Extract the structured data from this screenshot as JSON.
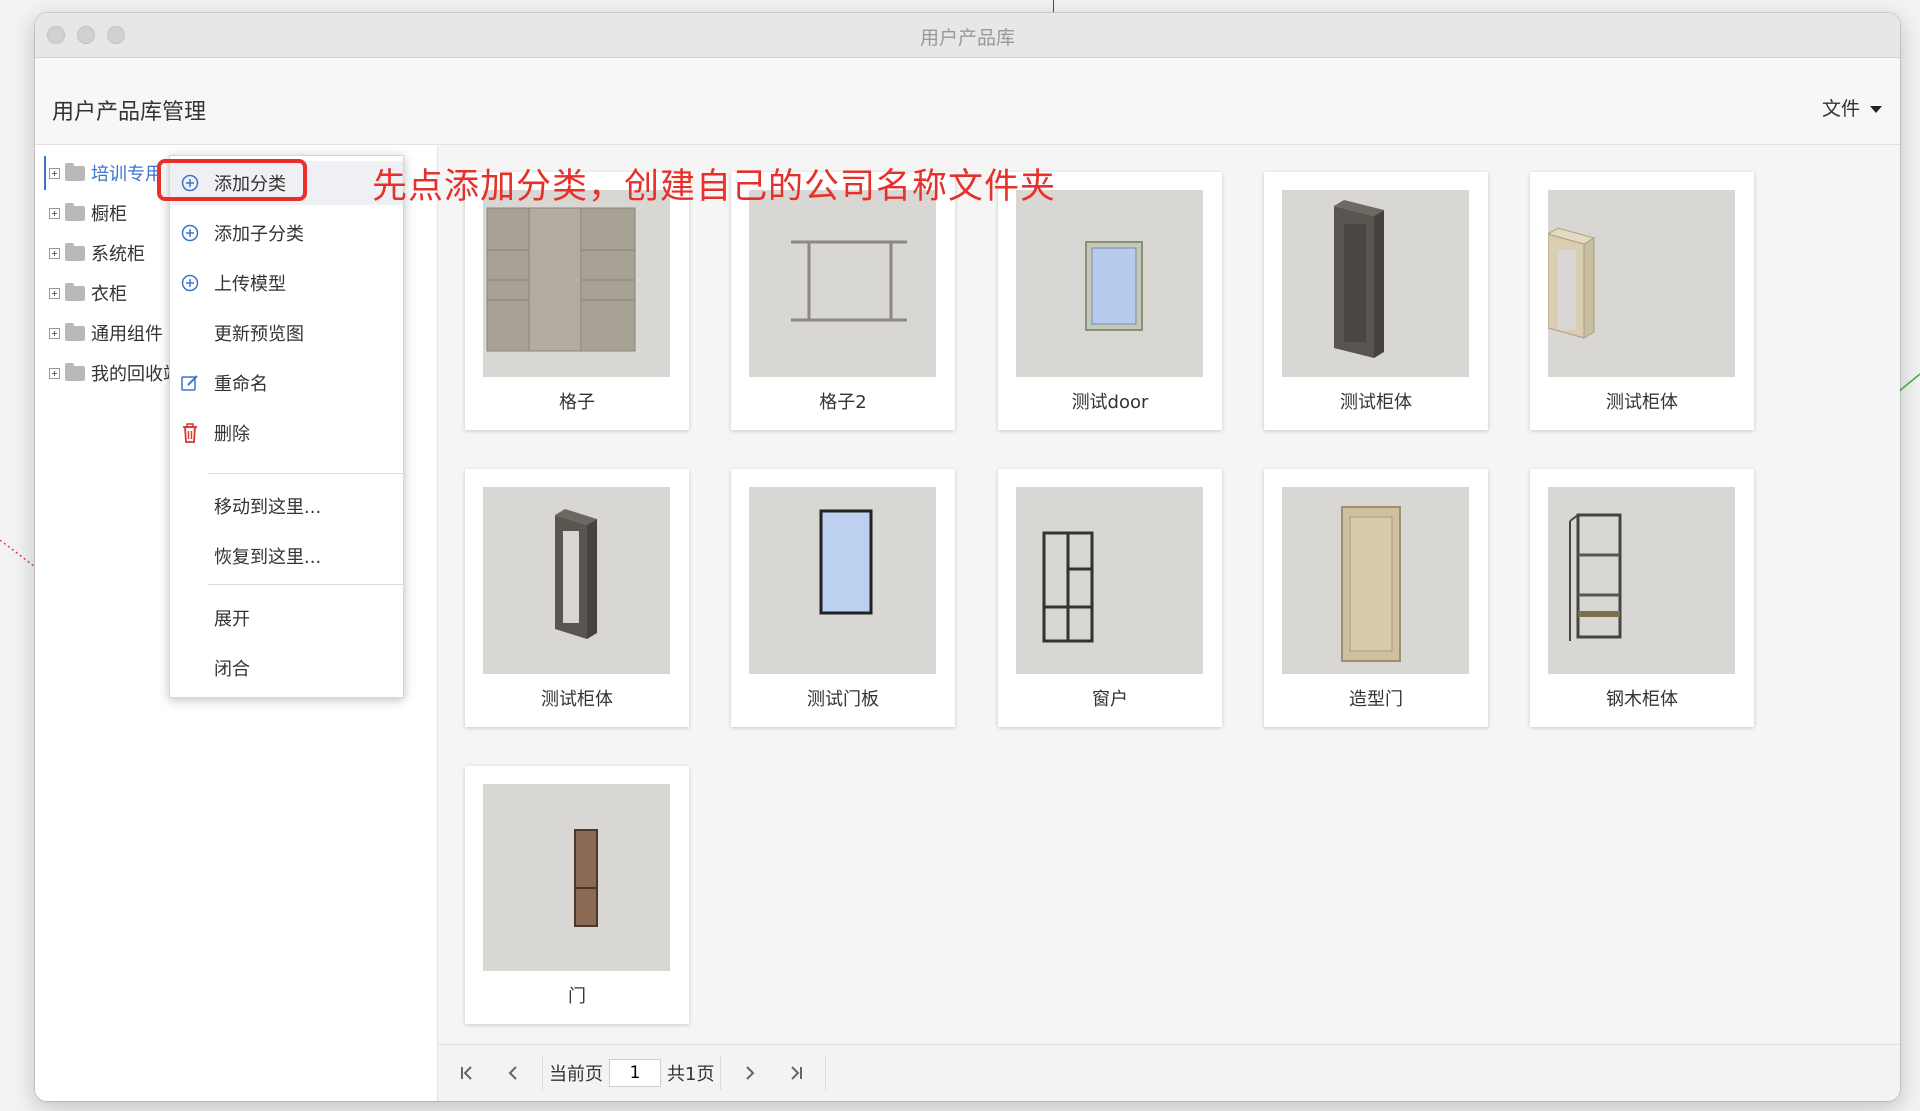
{
  "window": {
    "title": "用户产品库"
  },
  "header": {
    "title": "用户产品库管理",
    "file_menu": "文件"
  },
  "tree": {
    "items": [
      {
        "label": "培训专用",
        "selected": true
      },
      {
        "label": "橱柜"
      },
      {
        "label": "系统柜"
      },
      {
        "label": "衣柜"
      },
      {
        "label": "通用组件"
      },
      {
        "label": "我的回收站"
      }
    ]
  },
  "context_menu": {
    "items": [
      {
        "label": "添加分类",
        "icon": "plus-circle-icon"
      },
      {
        "label": "添加子分类",
        "icon": "plus-circle-icon"
      },
      {
        "label": "上传模型",
        "icon": "plus-circle-icon"
      },
      {
        "label": "更新预览图",
        "icon": ""
      },
      {
        "label": "重命名",
        "icon": "edit-icon"
      },
      {
        "label": "删除",
        "icon": "trash-icon"
      },
      {
        "label": "移动到这里..."
      },
      {
        "label": "恢复到这里..."
      },
      {
        "label": "展开"
      },
      {
        "label": "闭合"
      }
    ]
  },
  "annotation": {
    "text": "先点添加分类，创建自己的公司名称文件夹",
    "color": "#e8302a"
  },
  "products": [
    {
      "name": "格子"
    },
    {
      "name": "格子2"
    },
    {
      "name": "测试door"
    },
    {
      "name": "测试柜体"
    },
    {
      "name": "测试柜体"
    },
    {
      "name": "测试柜体"
    },
    {
      "name": "测试门板"
    },
    {
      "name": "窗户"
    },
    {
      "name": "造型门"
    },
    {
      "name": "钢木柜体"
    },
    {
      "name": "门"
    }
  ],
  "pager": {
    "current_label": "当前页",
    "current_value": "1",
    "total_label": "共1页"
  },
  "colors": {
    "accent": "#3c74c9",
    "highlight": "#e8302a"
  }
}
